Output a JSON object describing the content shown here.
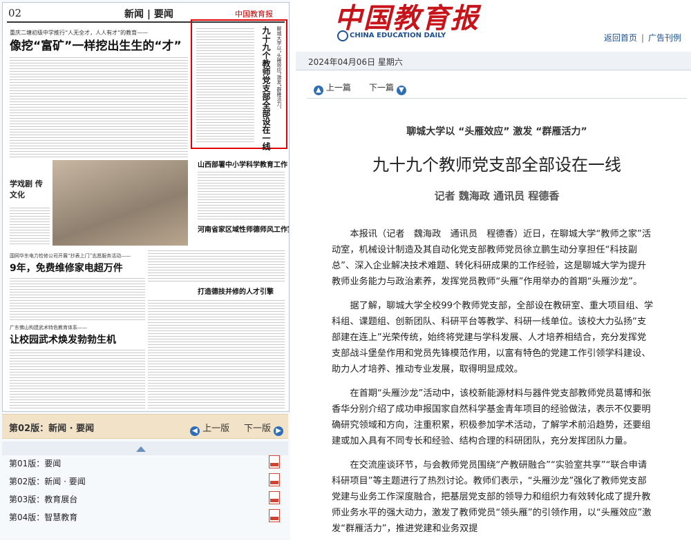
{
  "newspaper": {
    "page_number": "02",
    "section_title": "新闻 | 要闻",
    "nameplate": "中国教育报",
    "lead_kicker": "重庆二塘初级中学推行“人无全才，人人有才”的教育——",
    "lead_headline": "像挖“富矿”一样挖出生生的“才”",
    "highlight_headline": "九十九个教师党支部全部设在一线",
    "highlight_kicker": "聊城大学以“头雁效应”激发“群雁活力”",
    "photo_caption": "学戏剧 传文化",
    "story2_title": "山西部署中小学科学教育工作",
    "story3_title": "河南省家区域性师德师风工作室成立",
    "story4_kicker": "国网华东电力检修公司开展“抄表上门”志愿服务活动——",
    "story4_headline": "9年，免费维修家电超万件",
    "story5_kicker": "广东佛山构建武术特色教育体系——",
    "story5_headline": "让校园武术焕发勃勃生机",
    "story6_title": "打造德技并修的人才引擎"
  },
  "edition_bar": {
    "current": "第02版：新闻 · 要闻",
    "prev": "上一版",
    "next": "下一版"
  },
  "editions": [
    {
      "label": "第01版：要闻"
    },
    {
      "label": "第02版：新闻 · 要闻"
    },
    {
      "label": "第03版：教育展台"
    },
    {
      "label": "第04版：智慧教育"
    }
  ],
  "masthead": {
    "logo": "中国教育报",
    "logo_en": "CHINA EDUCATION DAILY",
    "home_link": "返回首页",
    "ad_link": "广告刊例"
  },
  "date": "2024年04月06日   星期六",
  "article_nav": {
    "prev": "上一篇",
    "next": "下一篇"
  },
  "article": {
    "subtitle": "聊城大学以 “头雁效应” 激发 “群雁活力”",
    "title": "九十九个教师党支部全部设在一线",
    "byline": "记者   魏海政   通讯员   程德香",
    "paragraphs": [
      "本报讯（记者　魏海政　通讯员　程德香）近日，在聊城大学“教师之家”活动室，机械设计制造及其自动化党支部教师党员徐立鹏生动分享担任“科技副总”、深入企业解决技术难题、转化科研成果的工作经验，这是聊城大学为提升教师业务能力与政治素养，发挥党员教师“头雁”作用举办的首期“头雁沙龙”。",
      "据了解，聊城大学全校99个教师党支部，全部设在教研室、重大项目组、学科组、课题组、创新团队、科研平台等教学、科研一线单位。该校大力弘扬“支部建在连上”光荣传统，始终将党建与学科发展、人才培养相结合，充分发挥党支部战斗堡垒作用和党员先锋模范作用，以富有特色的党建工作引领学科建设、助力人才培养、推动专业发展，取得明显成效。",
      "在首期“头雁沙龙”活动中，该校新能源材料与器件党支部教师党员葛博和张香华分别介绍了成功申报国家自然科学基金青年项目的经验做法，表示不仅要明确研究领域和方向，注重积累，积极参加学术活动，了解学术前沿趋势，还要组建或加入具有不同专长和经验、结构合理的科研团队，充分发挥团队力量。",
      "在交流座谈环节，与会教师党员围绕“产教研融合”“实验室共享”“联合申请科研项目”等主题进行了热烈讨论。教师们表示，“头雁沙龙”强化了教师党支部党建与业务工作深度融合，把基层党支部的领导力和组织力有效转化成了提升教师业务水平的强大动力，激发了教师党员“领头雁”的引领作用，以“头雁效应”激发“群雁活力”，推进党建和业务双提"
    ]
  },
  "colors": {
    "brand_red": "#c7141a",
    "link_blue": "#1f4f8f",
    "highlight_border": "#e00000",
    "edition_bar_bg": "#f2e3c8"
  }
}
